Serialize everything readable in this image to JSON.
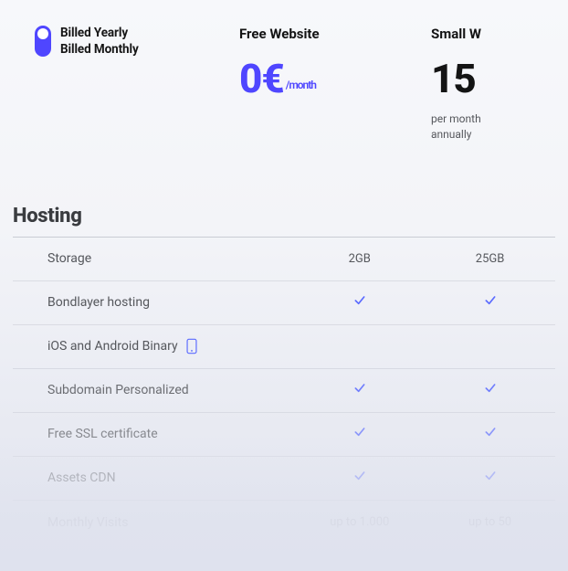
{
  "billing": {
    "yearly_label": "Billed Yearly",
    "monthly_label": "Billed Monthly",
    "selected": "yearly"
  },
  "plans": {
    "free": {
      "title": "Free Website",
      "price": "0€",
      "unit": "/month"
    },
    "small": {
      "title": "Small W",
      "price": "15",
      "sub_line1": "per month",
      "sub_line2": "annually"
    }
  },
  "section": {
    "title": "Hosting"
  },
  "features": {
    "storage": {
      "label": "Storage",
      "free": "2GB",
      "small": "25GB"
    },
    "hosting": {
      "label": "Bondlayer hosting",
      "free_check": true,
      "small_check": true
    },
    "binary": {
      "label": "iOS and Android Binary"
    },
    "subdomain": {
      "label": "Subdomain Personalized",
      "free_check": true,
      "small_check": true
    },
    "ssl": {
      "label": "Free SSL certificate",
      "free_check": true,
      "small_check": true
    },
    "cdn": {
      "label": "Assets CDN",
      "free_check": true,
      "small_check": true
    },
    "visits": {
      "label": "Monthly Visits",
      "free": "up to 1.000",
      "small": "up to 50"
    }
  }
}
